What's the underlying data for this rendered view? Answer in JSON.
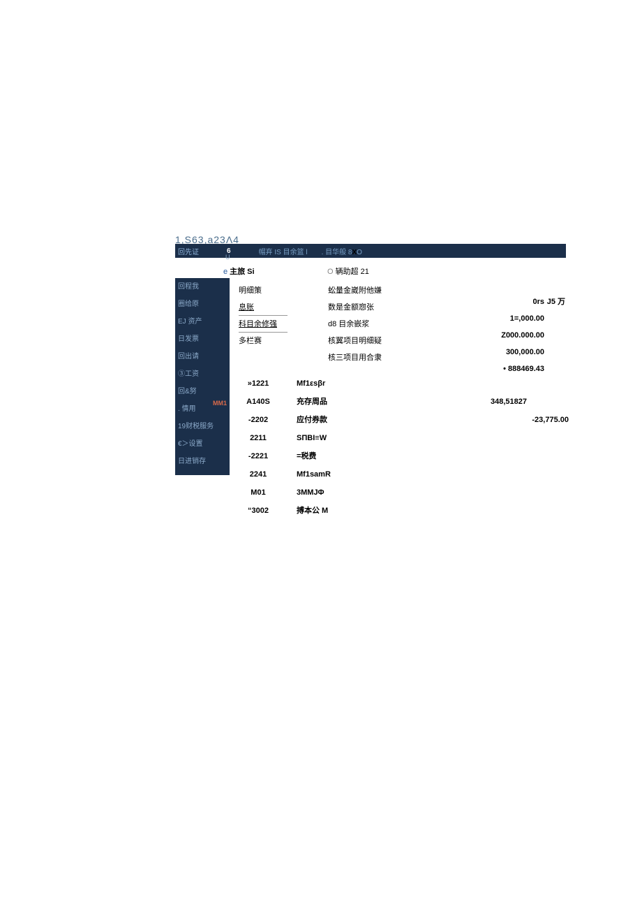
{
  "header_code": "1,S63,a23Λ4",
  "topbar": {
    "t1": "回先证",
    "tnum": "6",
    "u": "U",
    "t2_pre": "帽弃 IS 目余篮 l",
    "t3_pre": ". 目华般 8",
    "t3_x": "X",
    "t3_suf": "O"
  },
  "radio": {
    "r1": "主旅 Si",
    "r2": "辆助超 21"
  },
  "sidebar": [
    "回程我",
    "圈给原",
    "EJ 资产",
    "日发票",
    "回出请",
    "③工资",
    "回&努",
    ". 情用",
    "19财税服务",
    "€＞设置",
    "日进销存"
  ],
  "sidebar_badge": "MM1",
  "col_links": [
    {
      "t": "明细策",
      "u": false,
      "hr": false
    },
    {
      "t": "息账",
      "u": true,
      "hr": true
    },
    {
      "t": "科目余修强",
      "u": true,
      "hr": true
    },
    {
      "t": "多栏赛",
      "u": false,
      "hr": false
    }
  ],
  "col_mid": [
    "蚣量金崴附他嫌",
    "数是金额惌张",
    "d8 目余嵌浆",
    "核翼项目明细疑",
    "核三项目用合隶"
  ],
  "col_r1_h": "0rs",
  "col_r2_h": "J5 万",
  "col_r1": [
    "1=,000.00",
    "Z000.000.00",
    "300,000.00",
    "•  888469.43"
  ],
  "tbl": [
    {
      "c1": "»1221",
      "c2": "Mf1εsβr",
      "c3": "",
      "c4": ""
    },
    {
      "c1": "A140S",
      "c2": "充存周品",
      "c3": "348,51827",
      "c4": ""
    },
    {
      "c1": "-2202",
      "c2": "应付券款",
      "c3": "",
      "c4": "-23,775.00"
    },
    {
      "c1": "2211",
      "c2": "SΠBI≡W",
      "c3": "",
      "c4": ""
    },
    {
      "c1": "-2221",
      "c2": "=税费",
      "c3": "",
      "c4": ""
    },
    {
      "c1": "2241",
      "c2": "Mf1samR",
      "c3": "",
      "c4": ""
    },
    {
      "c1": "M01",
      "c2": "3MMJΦ",
      "c3": "",
      "c4": ""
    },
    {
      "c1": "“3002",
      "c2": "搏本公 M",
      "c3": "",
      "c4": ""
    }
  ]
}
